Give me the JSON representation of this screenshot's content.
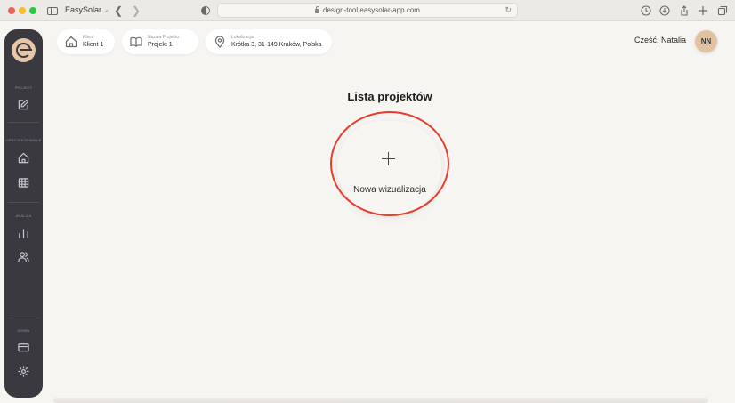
{
  "browser": {
    "tab_title": "EasySolar",
    "url": "design-tool.easysolar-app.com"
  },
  "sidebar": {
    "sections": [
      {
        "label": "PROJEKT"
      },
      {
        "label": "OPROJEKTOWANIE"
      },
      {
        "label": "ANALIZA"
      },
      {
        "label": "ADMIN"
      }
    ]
  },
  "header": {
    "client": {
      "label": "Klient",
      "value": "Klient 1"
    },
    "project": {
      "label": "Nazwa Projektu",
      "value": "Projekt 1"
    },
    "location": {
      "label": "Lokalizacja",
      "value": "Krótka 3, 31-149 Kraków, Polska"
    },
    "greeting": "Cześć, Natalia",
    "avatar_initials": "NN"
  },
  "main": {
    "title": "Lista projektów",
    "new_button_label": "Nowa wizualizacja"
  },
  "colors": {
    "sidebar_bg": "#3b3940",
    "accent": "#e8c6a8",
    "highlight": "#e53d2e"
  }
}
